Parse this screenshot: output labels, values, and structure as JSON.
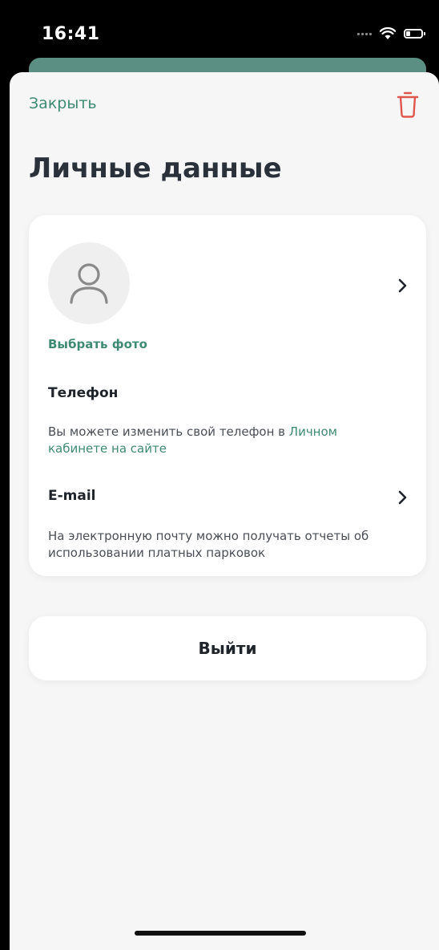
{
  "status_bar": {
    "time": "16:41",
    "icons": [
      "signal-icon",
      "wifi-icon",
      "battery-icon"
    ]
  },
  "header": {
    "close_label": "Закрыть",
    "delete_icon": "trash-icon"
  },
  "page": {
    "title": "Личные данные"
  },
  "profile": {
    "avatar_icon": "user-icon",
    "choose_photo_label": "Выбрать фото"
  },
  "phone": {
    "label": "Телефон",
    "description": "Вы можете изменить свой телефон в ",
    "link_text": "Личном кабинете на сайте"
  },
  "email": {
    "label": "E-mail",
    "description": "На электронную почту можно получать отчеты об использовании платных парковок"
  },
  "logout": {
    "label": "Выйти"
  },
  "colors": {
    "accent": "#3f8a74",
    "danger": "#e0564d",
    "title": "#2b313b",
    "sheet_bg": "#f6f6f6"
  }
}
